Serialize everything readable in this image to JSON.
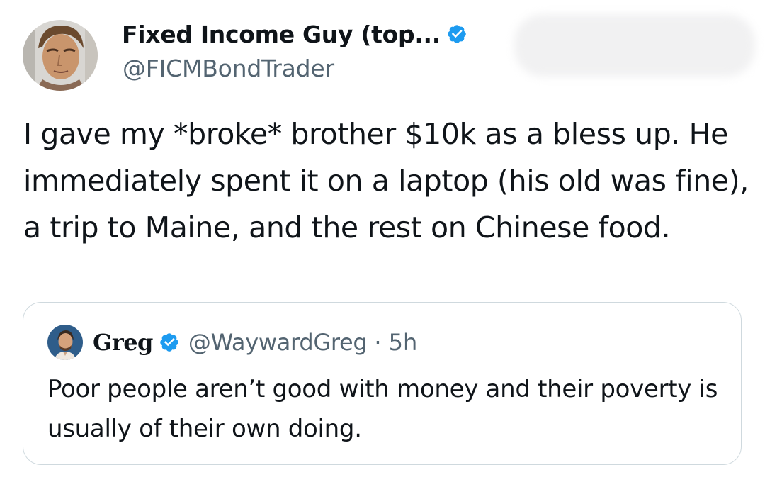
{
  "author": {
    "display_name": "Fixed Income Guy (top...",
    "handle": "@FICMBondTrader",
    "verified": true,
    "avatar": "profile-photo-icon"
  },
  "tweet": {
    "text": "I gave my *broke* brother $10k as a bless up. He immediately spent it on a laptop (his old was fine), a trip to Maine, and the rest on Chinese food."
  },
  "quoted_tweet": {
    "display_name": "Greg",
    "handle": "@WaywardGreg",
    "separator": "·",
    "time": "5h",
    "verified": true,
    "avatar": "profile-photo-icon",
    "text": "Poor people aren’t good with money and their poverty is usually of their own doing."
  },
  "colors": {
    "text": "#0f1419",
    "secondary": "#536471",
    "verified_badge": "#1d9bf0",
    "card_border": "#cfd9de",
    "background": "#ffffff"
  }
}
